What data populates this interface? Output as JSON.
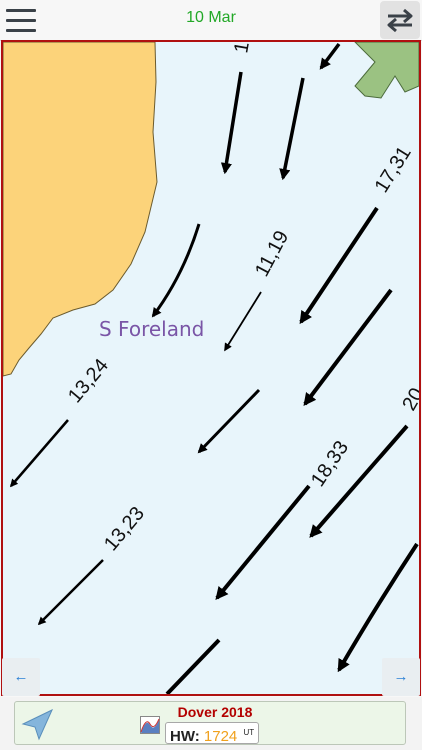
{
  "header": {
    "date": "10 Mar"
  },
  "map": {
    "place_label": "S Foreland",
    "rates": [
      "17,31",
      "11,19",
      "13,24",
      "18,33",
      "13,23",
      "20",
      "1"
    ],
    "colors": {
      "land": "#fcd37a",
      "sea": "#e8f5fb",
      "arrow": "#000000",
      "label": "#7a55a6"
    }
  },
  "nav": {
    "prev_label": "←",
    "next_label": "→"
  },
  "footer": {
    "port": "Dover 2018",
    "hw_label": "HW:",
    "hw_time": "1724",
    "hw_unit": "UT"
  },
  "icons": [
    "menu-icon",
    "swap-icon",
    "location-arrow-icon",
    "tide-curve-icon"
  ]
}
